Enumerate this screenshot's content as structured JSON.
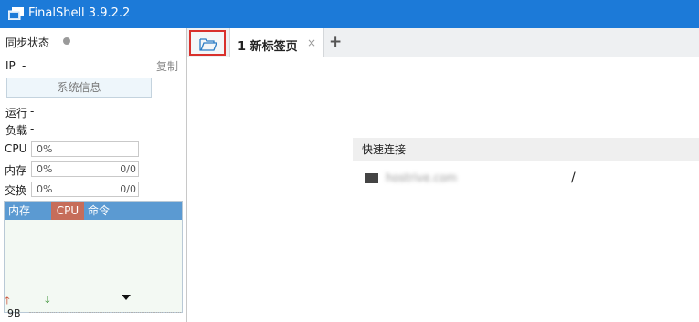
{
  "window": {
    "title": "FinalShell 3.9.2.2"
  },
  "sidebar": {
    "sync_label": "同步状态",
    "ip_label": "IP",
    "ip_value": "-",
    "copy_label": "复制",
    "sysinfo_label": "系统信息",
    "uptime_label": "运行",
    "uptime_value": "-",
    "load_label": "负载",
    "load_value": "-",
    "cpu": {
      "label": "CPU",
      "percent": "0%"
    },
    "memory": {
      "label": "内存",
      "percent": "0%",
      "amount": "0/0"
    },
    "swap": {
      "label": "交换",
      "percent": "0%",
      "amount": "0/0"
    },
    "process_table": {
      "columns": [
        "内存",
        "CPU",
        "命令"
      ]
    },
    "network": {
      "up_icon": "arrow-up-icon",
      "down_icon": "arrow-down-icon",
      "scale": "9B"
    }
  },
  "tabs": [
    {
      "label": "1 新标签页",
      "close": "×"
    }
  ],
  "new_tab_symbol": "+",
  "quick_connect": {
    "title": "快速连接",
    "items": [
      {
        "host": "hostrive.com",
        "path": "/"
      }
    ]
  },
  "colors": {
    "titlebar": "#1c7ad8",
    "table_header": "#5b9ad2",
    "cpu_header": "#c66d5a",
    "highlight_border": "#d9302c"
  }
}
